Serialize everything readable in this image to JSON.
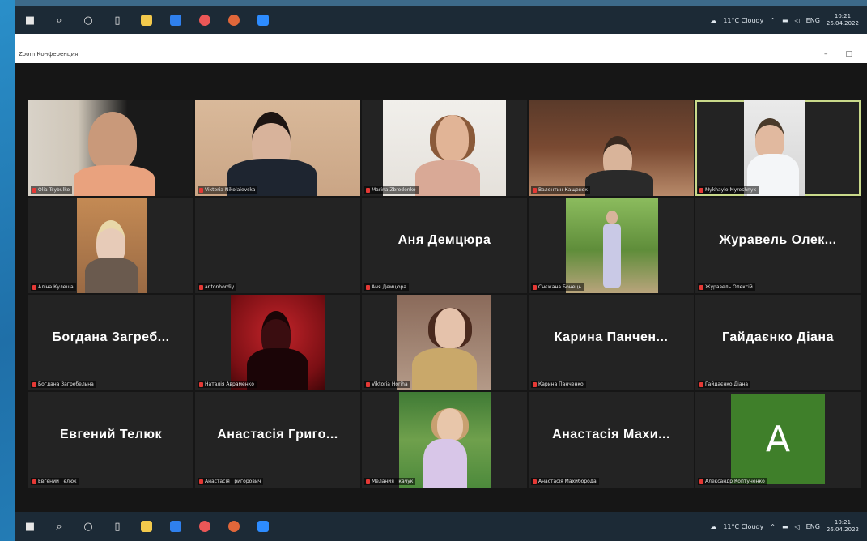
{
  "window": {
    "title": "Zoom Конференция",
    "minimize": "–",
    "maximize": "□"
  },
  "taskbar": {
    "weather": "11°C Cloudy",
    "lang": "ENG",
    "time": "10:21",
    "date": "26.04.2022"
  },
  "tiles": [
    {
      "name": "Olia Tsybulko",
      "video": true
    },
    {
      "name": "Viktoria Nikolaievska",
      "video": true
    },
    {
      "name": "Marina Zbrodenko",
      "video": true
    },
    {
      "name": "Валентин Кащенок",
      "video": true
    },
    {
      "name": "Mykhaylo Myroshnyk",
      "video": true,
      "active": true
    },
    {
      "name": "Аліна Кулеша",
      "video": true
    },
    {
      "name": "antonhordiy",
      "video": false,
      "display": ""
    },
    {
      "name": "Аня Демцюра",
      "video": false,
      "display": "Аня Демцюра"
    },
    {
      "name": "Снєжана Бонець",
      "video": true
    },
    {
      "name": "Журавель Олексій",
      "video": false,
      "display": "Журавель Олек..."
    },
    {
      "name": "Богдана Загребельна",
      "video": false,
      "display": "Богдана Загреб..."
    },
    {
      "name": "Наталія Авраменко",
      "video": true
    },
    {
      "name": "Viktoria Horiha",
      "video": true
    },
    {
      "name": "Карина Панченко",
      "video": false,
      "display": "Карина Панчен..."
    },
    {
      "name": "Гайдаєнко Діана",
      "video": false,
      "display": "Гайдаєнко Діана"
    },
    {
      "name": "Евгений Телюк",
      "video": false,
      "display": "Евгений Телюк"
    },
    {
      "name": "Анастасія Григорович",
      "video": false,
      "display": "Анастасія Григо..."
    },
    {
      "name": "Мелания Ткачук",
      "video": true
    },
    {
      "name": "Анастасія Махиборода",
      "video": false,
      "display": "Анастасія Махи..."
    },
    {
      "name": "Александр Коптуненко",
      "video": false,
      "display": "",
      "avatar": "A"
    }
  ],
  "colors": {
    "accent_active": "#c9d98a",
    "mic_muted": "#e53935",
    "avatar_bg": "#3f7f2a"
  }
}
